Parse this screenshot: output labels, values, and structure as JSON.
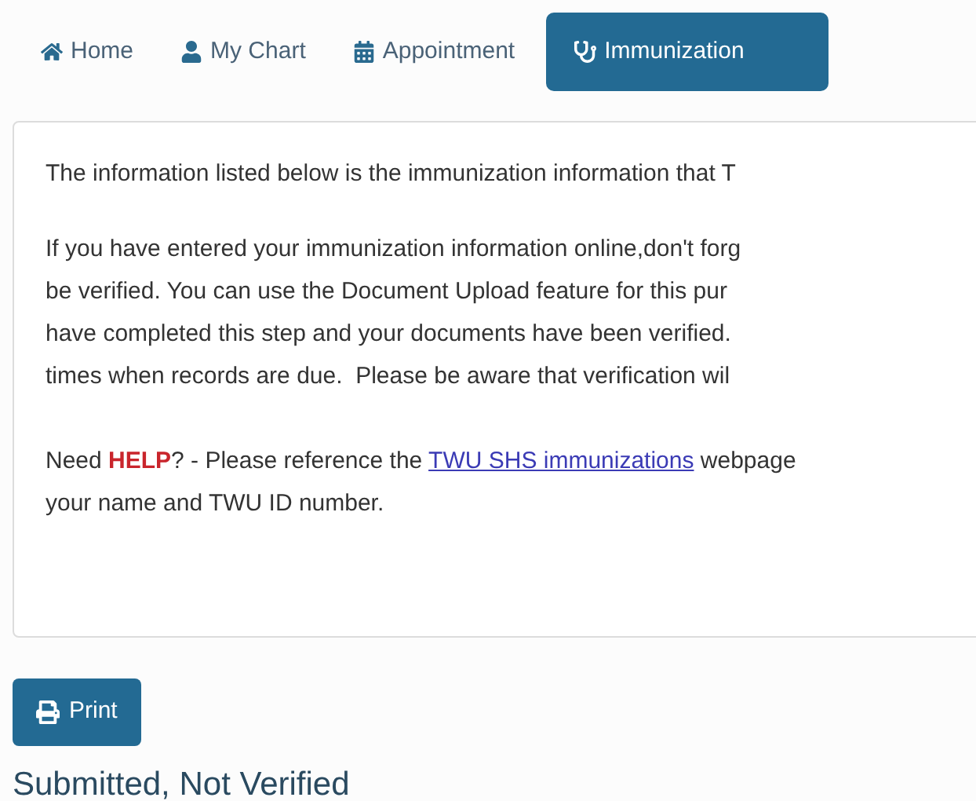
{
  "nav_tabs": [
    {
      "label": "Home",
      "kind": "home",
      "selected": false
    },
    {
      "label": "My Chart",
      "kind": "chart",
      "selected": false
    },
    {
      "label": "Appointment",
      "kind": "appointment",
      "selected": false
    },
    {
      "label": "Immunization",
      "kind": "immunization",
      "selected": true
    }
  ],
  "info_card": {
    "paragraphs": [
      {
        "lines": [
          "The information listed below is the immunization information that T"
        ]
      },
      {
        "lines": [
          "If you have entered your immunization information online,don't forg",
          "be verified. You can use the Document Upload feature for this pur",
          "have completed this step and your documents have been verified.",
          "times when records are due.  Please be aware that verification wil"
        ]
      }
    ],
    "help": {
      "before": "Need **HELP**? - Please reference the ",
      "link": "TWU SHS immunizations",
      "after": " webpage",
      "line2": "your name and TWU ID number."
    }
  },
  "print_button": "Print",
  "section_heading": "Submitted, Not Verified"
}
